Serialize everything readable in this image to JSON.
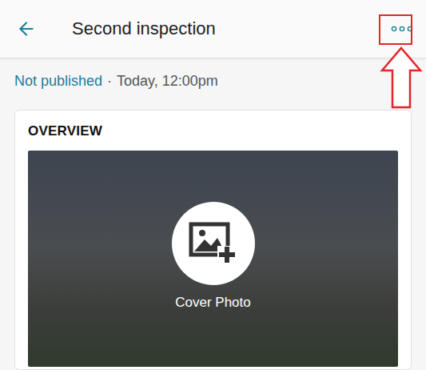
{
  "header": {
    "title": "Second inspection"
  },
  "status": {
    "label": "Not published",
    "separator": "·",
    "date": "Today, 12:00pm"
  },
  "card": {
    "title": "OVERVIEW",
    "cover": {
      "label": "Cover Photo"
    }
  }
}
